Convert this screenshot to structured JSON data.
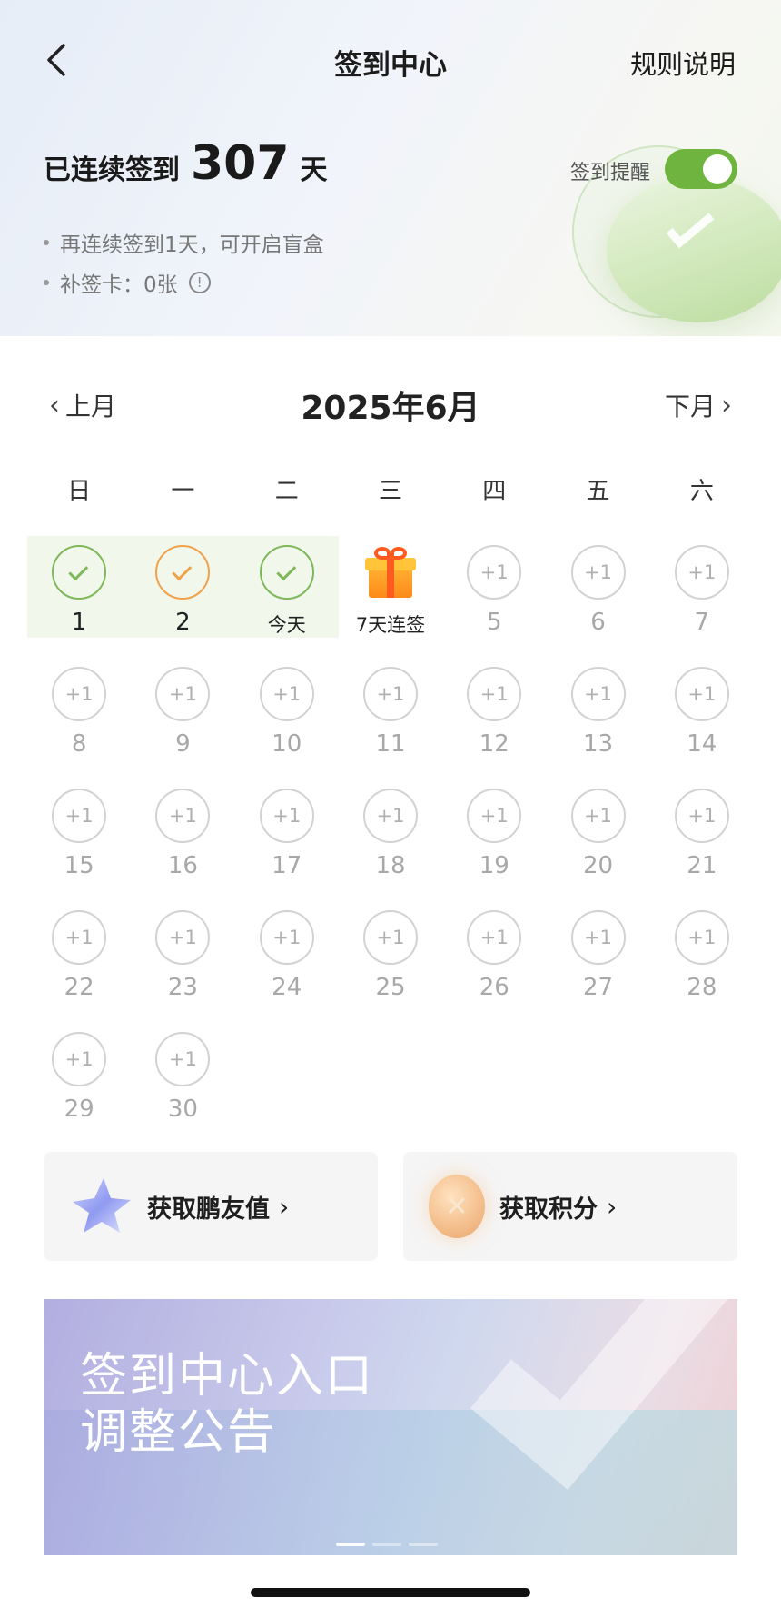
{
  "header": {
    "title": "签到中心",
    "rules_label": "规则说明",
    "streak_prefix": "已连续签到",
    "streak_days": "307",
    "streak_suffix": "天",
    "reminder_label": "签到提醒",
    "reminder_on": true,
    "info": [
      "再连续签到1天，可开启盲盒",
      "补签卡：0张"
    ],
    "info_icon": "!"
  },
  "calendar": {
    "prev_label": "上月",
    "next_label": "下月",
    "month_title": "2025年6月",
    "weekdays": [
      "日",
      "一",
      "二",
      "三",
      "四",
      "五",
      "六"
    ],
    "pending_badge": "+1",
    "signed_days": [
      {
        "label": "1",
        "style": "green"
      },
      {
        "label": "2",
        "style": "orange"
      },
      {
        "label": "今天",
        "style": "green"
      }
    ],
    "bonus_day": {
      "label": "7天连签",
      "icon": "gift-icon"
    },
    "pending_days": [
      "5",
      "6",
      "7",
      "8",
      "9",
      "10",
      "11",
      "12",
      "13",
      "14",
      "15",
      "16",
      "17",
      "18",
      "19",
      "20",
      "21",
      "22",
      "23",
      "24",
      "25",
      "26",
      "27",
      "28",
      "29",
      "30"
    ]
  },
  "rewards": [
    {
      "label": "获取鹏友值",
      "icon": "star-icon",
      "arrow": "›"
    },
    {
      "label": "获取积分",
      "icon": "coin-icon",
      "arrow": "›"
    }
  ],
  "banner": {
    "line1": "签到中心入口",
    "line2": "调整公告",
    "slide_count": 3,
    "active_slide": 1
  },
  "colors": {
    "toggle_on": "#6fb43f",
    "check_green": "#7eb85a",
    "check_orange": "#f0a24a"
  }
}
